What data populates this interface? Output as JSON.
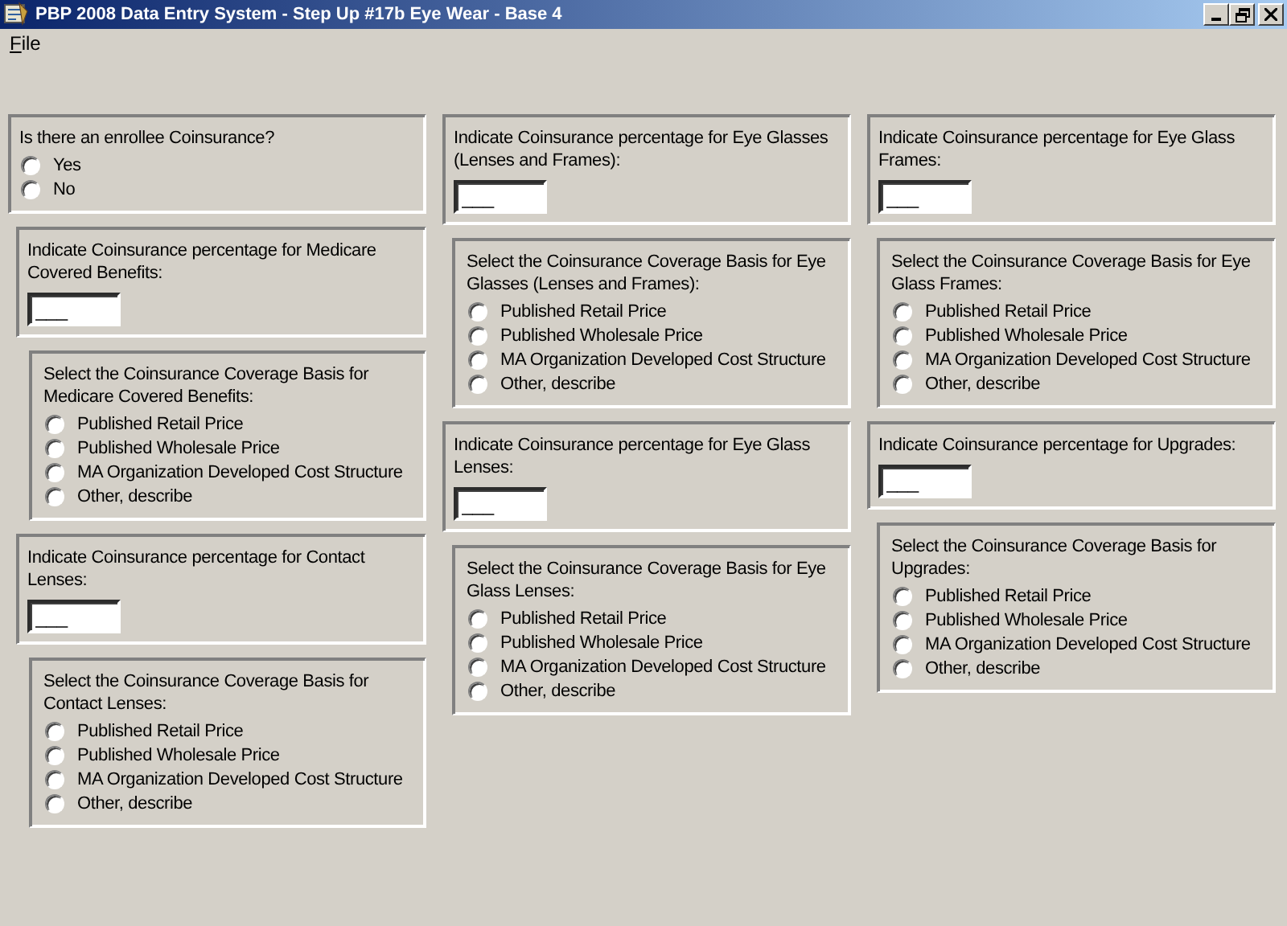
{
  "window": {
    "title": "PBP 2008 Data Entry System - Step Up #17b Eye Wear - Base 4"
  },
  "menu": [
    {
      "label": "File"
    }
  ],
  "columns": [
    {
      "panels": [
        {
          "kind": "choice",
          "question": "Is there an enrollee Coinsurance?",
          "options": [
            {
              "label": "Yes",
              "selected": false
            },
            {
              "label": "No",
              "selected": false
            }
          ]
        },
        {
          "kind": "percent",
          "question": "Indicate Coinsurance percentage for Medicare Covered Benefits:",
          "value": "___"
        },
        {
          "kind": "basis",
          "question": "Select the Coinsurance Coverage Basis for Medicare Covered Benefits:",
          "options": [
            {
              "label": "Published Retail Price",
              "selected": false
            },
            {
              "label": "Published Wholesale Price",
              "selected": false
            },
            {
              "label": "MA Organization Developed Cost Structure",
              "selected": false
            },
            {
              "label": "Other, describe",
              "selected": false
            }
          ]
        },
        {
          "kind": "percent",
          "question": "Indicate Coinsurance percentage for Contact Lenses:",
          "value": "___"
        },
        {
          "kind": "basis",
          "question": "Select the Coinsurance Coverage Basis for Contact Lenses:",
          "options": [
            {
              "label": "Published Retail Price",
              "selected": false
            },
            {
              "label": "Published Wholesale Price",
              "selected": false
            },
            {
              "label": "MA Organization Developed Cost Structure",
              "selected": false
            },
            {
              "label": "Other, describe",
              "selected": false
            }
          ]
        }
      ]
    },
    {
      "panels": [
        {
          "kind": "percent",
          "question": "Indicate Coinsurance percentage for Eye Glasses (Lenses and Frames):",
          "value": "___"
        },
        {
          "kind": "basis",
          "question": "Select the Coinsurance Coverage Basis for Eye Glasses (Lenses and Frames):",
          "options": [
            {
              "label": "Published Retail Price",
              "selected": false
            },
            {
              "label": "Published Wholesale Price",
              "selected": false
            },
            {
              "label": "MA Organization Developed Cost Structure",
              "selected": false
            },
            {
              "label": "Other, describe",
              "selected": false
            }
          ]
        },
        {
          "kind": "percent",
          "question": "Indicate Coinsurance percentage for Eye Glass Lenses:",
          "value": "___"
        },
        {
          "kind": "basis",
          "question": "Select the Coinsurance Coverage Basis for Eye Glass Lenses:",
          "options": [
            {
              "label": "Published Retail Price",
              "selected": false
            },
            {
              "label": "Published Wholesale Price",
              "selected": false
            },
            {
              "label": "MA Organization Developed Cost Structure",
              "selected": false
            },
            {
              "label": "Other, describe",
              "selected": false
            }
          ]
        }
      ]
    },
    {
      "panels": [
        {
          "kind": "percent",
          "question": "Indicate Coinsurance percentage for Eye Glass Frames:",
          "value": "___"
        },
        {
          "kind": "basis",
          "question": "Select the Coinsurance Coverage Basis for Eye Glass Frames:",
          "options": [
            {
              "label": "Published Retail Price",
              "selected": false
            },
            {
              "label": "Published Wholesale Price",
              "selected": false
            },
            {
              "label": "MA Organization Developed Cost Structure",
              "selected": false
            },
            {
              "label": "Other, describe",
              "selected": false
            }
          ]
        },
        {
          "kind": "percent",
          "question": "Indicate Coinsurance percentage for Upgrades:",
          "value": "___"
        },
        {
          "kind": "basis",
          "question": "Select the Coinsurance Coverage Basis for Upgrades:",
          "options": [
            {
              "label": "Published Retail Price",
              "selected": false
            },
            {
              "label": "Published Wholesale Price",
              "selected": false
            },
            {
              "label": "MA Organization Developed Cost Structure",
              "selected": false
            },
            {
              "label": "Other, describe",
              "selected": false
            }
          ]
        }
      ]
    }
  ]
}
